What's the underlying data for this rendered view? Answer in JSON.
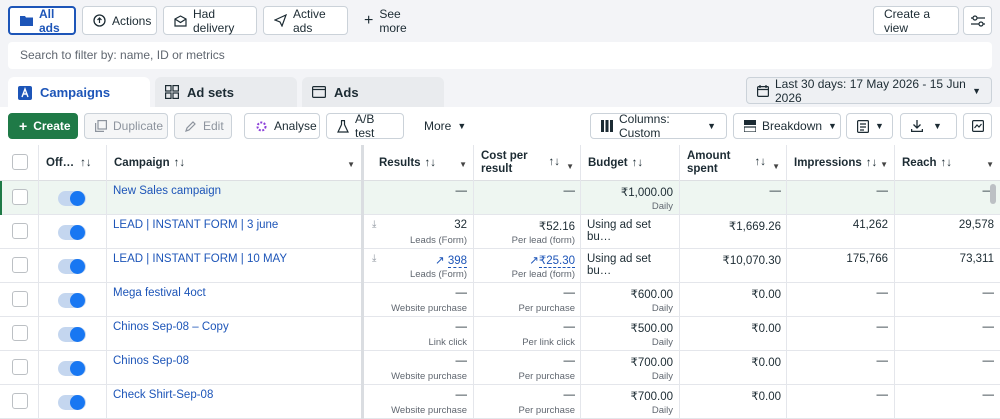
{
  "filter_bar": {
    "all_ads": "All ads",
    "actions": "Actions",
    "had_delivery": "Had delivery",
    "active_ads": "Active ads",
    "see_more": "See more",
    "create_view": "Create a view"
  },
  "search": {
    "placeholder": "Search to filter by: name, ID or metrics"
  },
  "tabs": {
    "campaigns": "Campaigns",
    "ad_sets": "Ad sets",
    "ads": "Ads"
  },
  "date_range": "Last 30 days: 17 May 2026 - 15 Jun 2026",
  "toolbar": {
    "create": "Create",
    "duplicate": "Duplicate",
    "edit": "Edit",
    "analyse": "Analyse",
    "ab_test": "A/B test",
    "more": "More",
    "columns": "Columns: Custom",
    "breakdown": "Breakdown"
  },
  "columns": {
    "off_on": "Off…",
    "campaign": "Campaign",
    "results": "Results",
    "cost_per_result_1": "Cost per",
    "cost_per_result_2": "result",
    "budget": "Budget",
    "amount_spent_1": "Amount",
    "amount_spent_2": "spent",
    "impressions": "Impressions",
    "reach": "Reach"
  },
  "rows": [
    {
      "campaign": "New Sales campaign",
      "results": "—",
      "results_sub": "",
      "cost": "—",
      "cost_sub": "",
      "budget": "₹1,000.00",
      "budget_sub": "Daily",
      "spent": "—",
      "impressions": "—",
      "reach": "—"
    },
    {
      "campaign": "LEAD | INSTANT FORM | 3 june",
      "results": "32",
      "results_sub": "Leads (Form)",
      "cost": "₹52.16",
      "cost_sub": "Per lead (form)",
      "budget": "Using ad set bu…",
      "budget_sub": "",
      "spent": "₹1,669.26",
      "impressions": "41,262",
      "reach": "29,578"
    },
    {
      "campaign": "LEAD | INSTANT FORM | 10 MAY",
      "results": "398",
      "results_sub": "Leads (Form)",
      "cost": "₹25.30",
      "cost_sub": "Per lead (form)",
      "budget": "Using ad set bu…",
      "budget_sub": "",
      "spent": "₹10,070.30",
      "impressions": "175,766",
      "reach": "73,311"
    },
    {
      "campaign": "Mega festival 4oct",
      "results": "—",
      "results_sub": "Website purchase",
      "cost": "—",
      "cost_sub": "Per purchase",
      "budget": "₹600.00",
      "budget_sub": "Daily",
      "spent": "₹0.00",
      "impressions": "—",
      "reach": "—"
    },
    {
      "campaign": "Chinos Sep-08 – Copy",
      "results": "—",
      "results_sub": "Link click",
      "cost": "—",
      "cost_sub": "Per link click",
      "budget": "₹500.00",
      "budget_sub": "Daily",
      "spent": "₹0.00",
      "impressions": "—",
      "reach": "—"
    },
    {
      "campaign": "Chinos Sep-08",
      "results": "—",
      "results_sub": "Website purchase",
      "cost": "—",
      "cost_sub": "Per purchase",
      "budget": "₹700.00",
      "budget_sub": "Daily",
      "spent": "₹0.00",
      "impressions": "—",
      "reach": "—"
    },
    {
      "campaign": "Check Shirt-Sep-08",
      "results": "—",
      "results_sub": "Website purchase",
      "cost": "—",
      "cost_sub": "Per purchase",
      "budget": "₹700.00",
      "budget_sub": "Daily",
      "spent": "₹0.00",
      "impressions": "—",
      "reach": "—"
    }
  ]
}
